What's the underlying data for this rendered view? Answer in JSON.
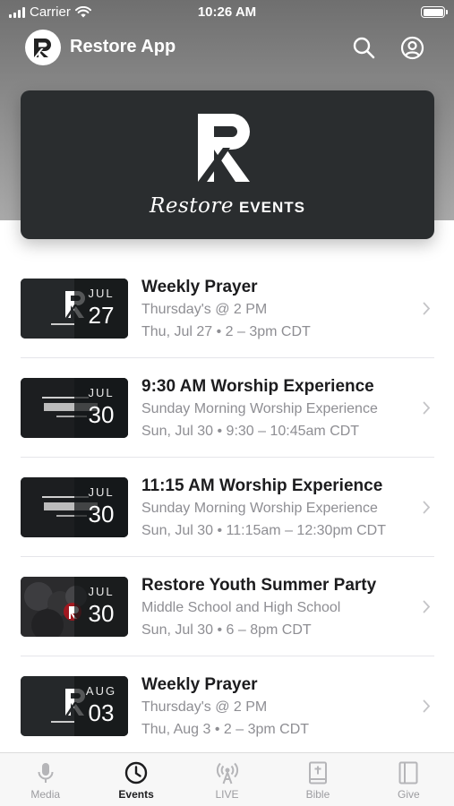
{
  "status_bar": {
    "carrier": "Carrier",
    "time": "10:26 AM"
  },
  "app_bar": {
    "title": "Restore App",
    "logo_letter": "R",
    "icons": [
      "search-icon",
      "account-icon"
    ]
  },
  "banner": {
    "logo_letter": "R",
    "script_text": "Restore",
    "events_text": "EVENTS"
  },
  "events": [
    {
      "title": "Weekly Prayer",
      "subtitle": "Thursday's @ 2 PM",
      "datetime": "Thu, Jul 27 • 2 – 3pm CDT",
      "month": "JUL",
      "day": "27",
      "thumb_style": "restore"
    },
    {
      "title": "9:30 AM Worship Experience",
      "subtitle": "Sunday Morning Worship Experience",
      "datetime": "Sun, Jul 30 • 9:30 – 10:45am CDT",
      "month": "JUL",
      "day": "30",
      "thumb_style": "home"
    },
    {
      "title": "11:15 AM Worship Experience",
      "subtitle": "Sunday Morning Worship Experience",
      "datetime": "Sun, Jul 30 • 11:15am – 12:30pm CDT",
      "month": "JUL",
      "day": "30",
      "thumb_style": "home"
    },
    {
      "title": "Restore Youth Summer Party",
      "subtitle": "Middle School and High School",
      "datetime": "Sun, Jul 30 • 6 – 8pm CDT",
      "month": "JUL",
      "day": "30",
      "thumb_style": "youth"
    },
    {
      "title": "Weekly Prayer",
      "subtitle": "Thursday's @ 2 PM",
      "datetime": "Thu, Aug 3 • 2 – 3pm CDT",
      "month": "AUG",
      "day": "03",
      "thumb_style": "restore"
    }
  ],
  "tab_bar": {
    "tabs": [
      {
        "label": "Media",
        "icon": "microphone-icon",
        "active": false
      },
      {
        "label": "Events",
        "icon": "clock-icon",
        "active": true
      },
      {
        "label": "LIVE",
        "icon": "broadcast-icon",
        "active": false
      },
      {
        "label": "Bible",
        "icon": "bible-icon",
        "active": false
      },
      {
        "label": "Give",
        "icon": "give-icon",
        "active": false
      }
    ]
  },
  "colors": {
    "header_gray": "#8a8a8a",
    "banner_dark": "#2a2d2f",
    "text_primary": "#1c1c1e",
    "text_secondary": "#8e8e93",
    "tab_inactive": "#9c9ca0"
  }
}
